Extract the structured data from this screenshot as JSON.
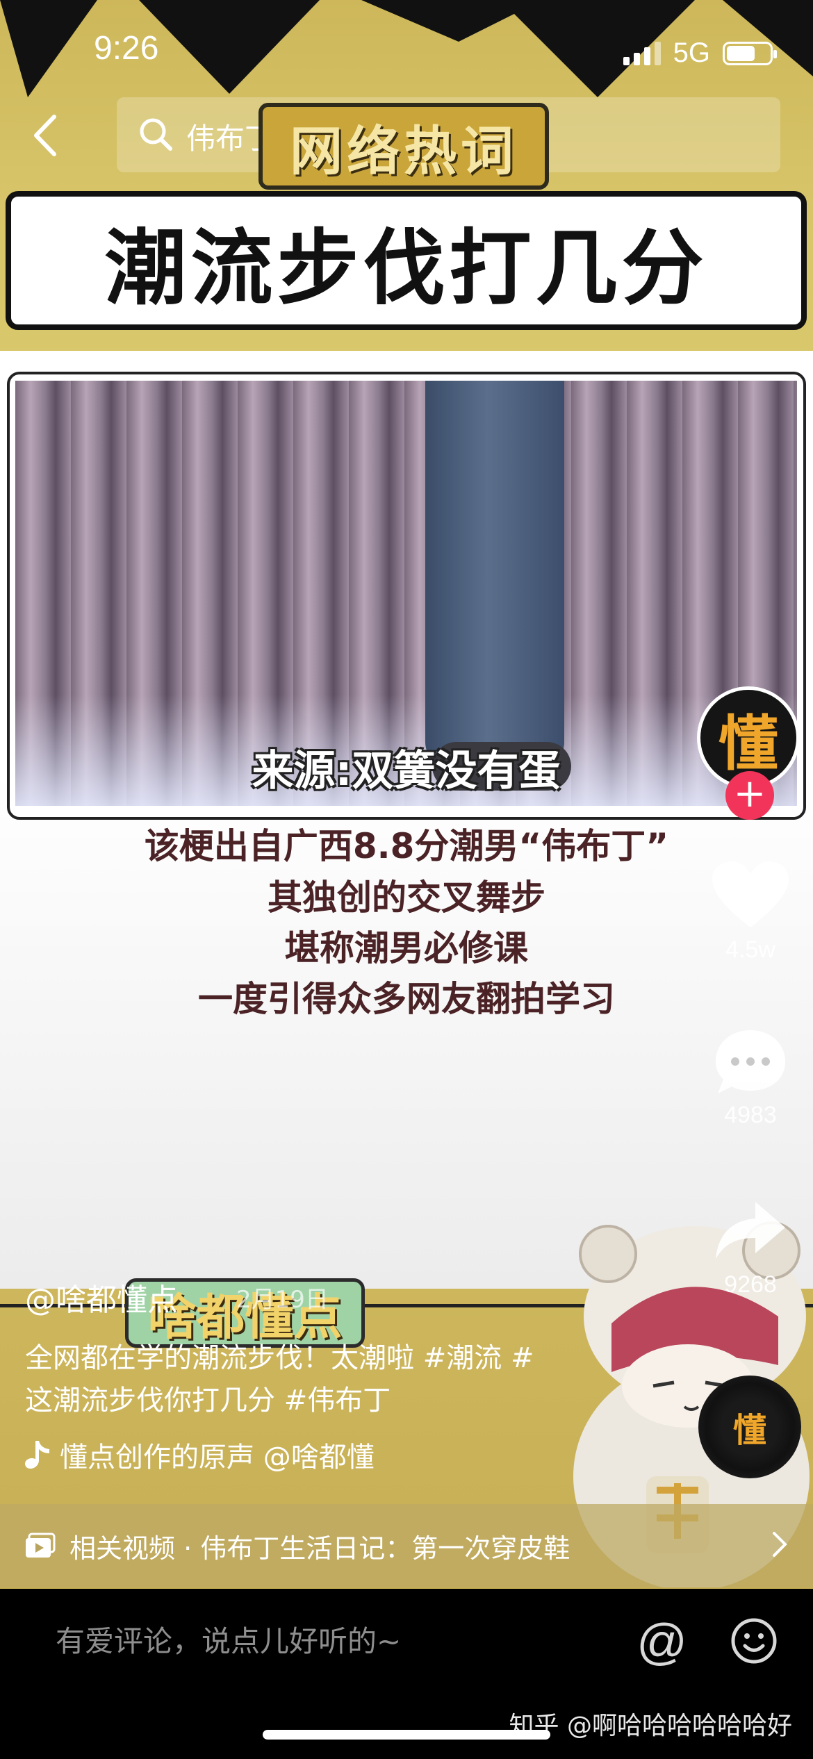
{
  "status_bar": {
    "time": "9:26",
    "network": "5G",
    "battery_level": 0.65
  },
  "search": {
    "query": "伟布丁"
  },
  "banner": {
    "tag": "网络热词",
    "title": "潮流步伐打几分"
  },
  "video": {
    "source_caption": "来源:双簧没有蛋"
  },
  "subtitles": [
    "该梗出自广西8.8分潮男“伟布丁”",
    "其独创的交叉舞步",
    "堪称潮男必修课",
    "一度引得众多网友翻拍学习"
  ],
  "brand_label": "啥都懂点",
  "creator": {
    "avatar_char": "懂",
    "follow_symbol": "+"
  },
  "actions": {
    "likes": "4.5w",
    "comments": "4983",
    "shares": "9268"
  },
  "post": {
    "author": "@啥都懂点",
    "date": "2月19日",
    "desc_line1": "全网都在学的潮流步伐！太潮啦 #潮流 #",
    "desc_line2": "这潮流步伐你打几分 #伟布丁"
  },
  "music": {
    "text": "懂点创作的原声   @啥都懂",
    "disc_char": "懂"
  },
  "related": {
    "text": "相关视频 · 伟布丁生活日记：第一次穿皮鞋"
  },
  "comment": {
    "placeholder": "有爱评论，说点儿好听的~",
    "at_symbol": "@"
  },
  "watermark": "知乎 @啊哈哈哈哈哈哈好",
  "colors": {
    "banner_yellow": "#d8c56a",
    "follow_red": "#f2345a",
    "subtitle_text": "#4b2326"
  },
  "icons": [
    "back-icon",
    "search-icon",
    "heart-icon",
    "comment-icon",
    "share-icon",
    "music-note-icon",
    "video-icon",
    "chevron-right-icon",
    "emoji-icon"
  ]
}
